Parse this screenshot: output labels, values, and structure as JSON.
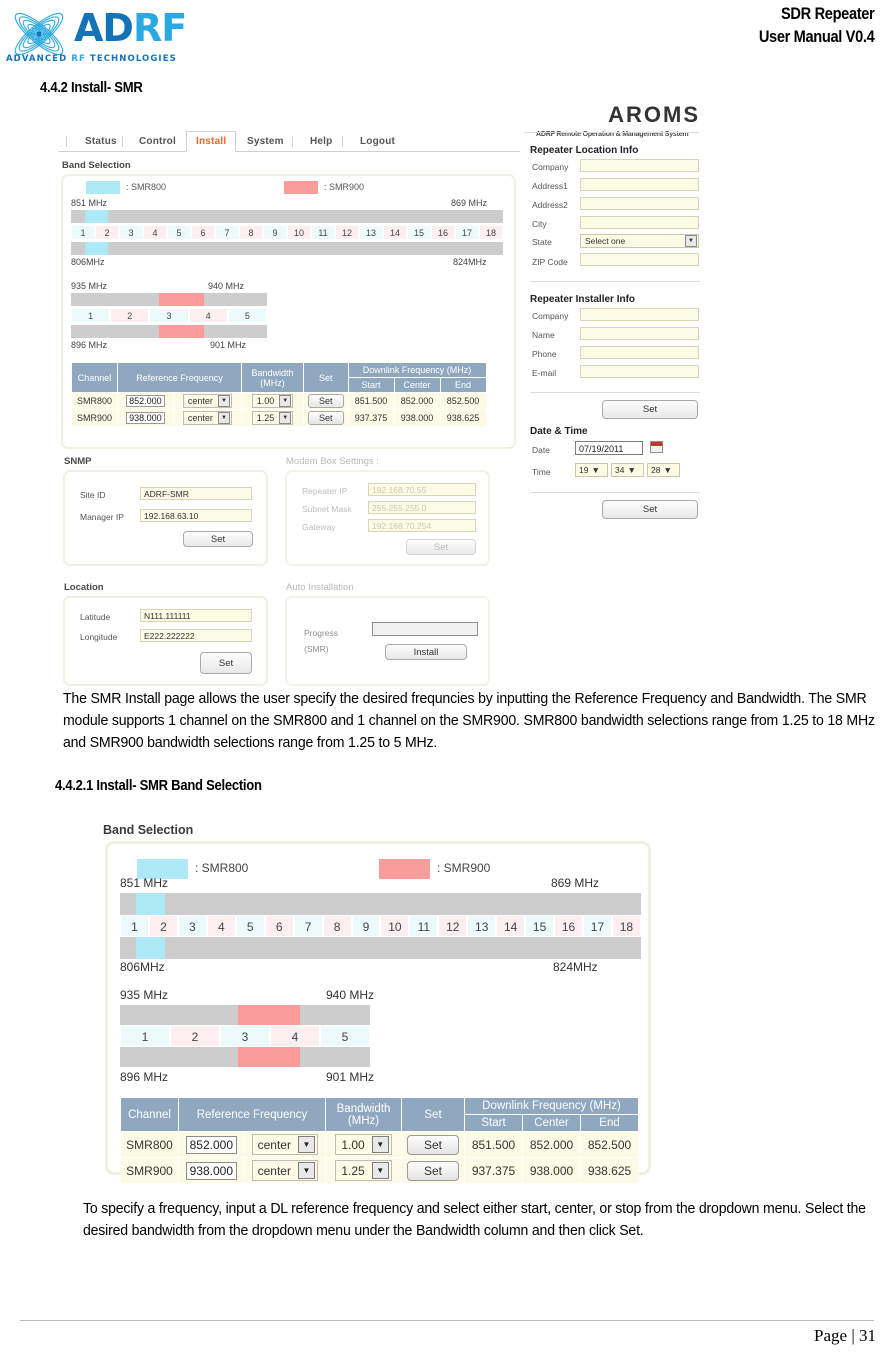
{
  "header": {
    "logo_name": "ADRF",
    "logo_ad": "AD",
    "logo_rf": "RF",
    "logo_tagline_1": "ADVANCED ",
    "logo_tagline_rf": "RF",
    "logo_tagline_2": " TECHNOLOGIES",
    "doc_title_line1": "SDR Repeater",
    "doc_title_line2": "User Manual V0.4"
  },
  "sections": {
    "h_442": "4.4.2 Install- SMR",
    "h_4421": "4.4.2.1 Install- SMR Band Selection"
  },
  "paragraphs": {
    "p1": "The SMR Install page allows the user specify the desired frequncies by inputting the Reference Frequency and Bandwidth.   The SMR module supports 1 channel on the SMR800 and 1 channel on the SMR900.   SMR800 bandwidth selections range from 1.25 to 18 MHz and SMR900 bandwidth selections range from 1.25 to 5 MHz.",
    "p2": "To specify a frequency, input a DL reference frequency and select either start, center, or stop from the dropdown menu.   Select the desired bandwidth from the dropdown menu under the Bandwidth column and then click Set."
  },
  "footer": {
    "page_label": "Page | 31"
  },
  "app": {
    "brand": {
      "title": "AROMS",
      "subtitle": "ADRF Remote Operation & Management System"
    },
    "nav": {
      "items": [
        "Status",
        "Control",
        "Install",
        "System",
        "Help",
        "Logout"
      ],
      "active": "Install"
    },
    "band_selection": {
      "label": "Band Selection",
      "legend": [
        {
          "swatch_color": "#aee9f7",
          "text": ": SMR800"
        },
        {
          "swatch_color": "#fa9c99",
          "text": ": SMR900"
        }
      ],
      "smr800": {
        "top_left": "851 MHz",
        "top_right": "869 MHz",
        "bottom_left": "806MHz",
        "bottom_right": "824MHz",
        "channels": [
          "1",
          "2",
          "3",
          "4",
          "5",
          "6",
          "7",
          "8",
          "9",
          "10",
          "11",
          "12",
          "13",
          "14",
          "15",
          "16",
          "17",
          "18"
        ],
        "highlight_color": "#aee9f7",
        "highlight_channel": 2
      },
      "smr900": {
        "top_left": "935 MHz",
        "top_right": "940 MHz",
        "bottom_left": "896 MHz",
        "bottom_right": "901 MHz",
        "channels": [
          "1",
          "2",
          "3",
          "4",
          "5"
        ],
        "highlight_color": "#fa9c99",
        "highlight_channel": 4
      },
      "table": {
        "headers": {
          "channel": "Channel",
          "reference_frequency": "Reference Frequency",
          "bandwidth_l1": "Bandwidth",
          "bandwidth_l2": "(MHz)",
          "set": "Set",
          "downlink": "Downlink Frequency (MHz)",
          "start": "Start",
          "center": "Center",
          "end": "End"
        },
        "rows": [
          {
            "channel": "SMR800",
            "ref_freq": "852.000",
            "ref_mode": "center",
            "bandwidth": "1.00",
            "set_label": "Set",
            "start": "851.500",
            "center": "852.000",
            "end": "852.500"
          },
          {
            "channel": "SMR900",
            "ref_freq": "938.000",
            "ref_mode": "center",
            "bandwidth": "1.25",
            "set_label": "Set",
            "start": "937.375",
            "center": "938.000",
            "end": "938.625"
          }
        ]
      }
    },
    "snmp": {
      "label": "SNMP",
      "site_id_label": "Site ID",
      "site_id_value": "ADRF-SMR",
      "manager_ip_label": "Manager IP",
      "manager_ip_value": "192.168.63.10",
      "set_label": "Set"
    },
    "modem_box": {
      "label": "Modem Box Settings :",
      "repeater_ip_label": "Repeater IP",
      "repeater_ip_value": "192.168.70.55",
      "subnet_mask_label": "Subnet Mask",
      "subnet_mask_value": "255.255.255.0",
      "gateway_label": "Gateway",
      "gateway_value": "192.168.70.254",
      "set_label": "Set"
    },
    "location": {
      "label": "Location",
      "latitude_label": "Latitude",
      "latitude_value": "N111.111111",
      "longitude_label": "Longitude",
      "longitude_value": "E222.222222",
      "set_label": "Set"
    },
    "auto_install": {
      "label": "Auto Installation",
      "progress_label_l1": "Progress",
      "progress_label_l2": "(SMR)",
      "install_label": "Install"
    },
    "repeater_location_info": {
      "title": "Repeater Location Info",
      "fields": [
        {
          "label": "Company",
          "value": ""
        },
        {
          "label": "Address1",
          "value": ""
        },
        {
          "label": "Address2",
          "value": ""
        },
        {
          "label": "City",
          "value": ""
        }
      ],
      "state_label": "State",
      "state_value": "Select one",
      "zip_label": "ZIP Code",
      "zip_value": ""
    },
    "repeater_installer_info": {
      "title": "Repeater Installer Info",
      "fields": [
        {
          "label": "Company",
          "value": ""
        },
        {
          "label": "Name",
          "value": ""
        },
        {
          "label": "Phone",
          "value": ""
        },
        {
          "label": "E-mail",
          "value": ""
        }
      ],
      "set_label": "Set"
    },
    "date_time": {
      "title": "Date & Time",
      "date_label": "Date",
      "date_value": "07/19/2011",
      "time_label": "Time",
      "hour": "19",
      "minute": "34",
      "second": "28",
      "set_label": "Set"
    }
  }
}
